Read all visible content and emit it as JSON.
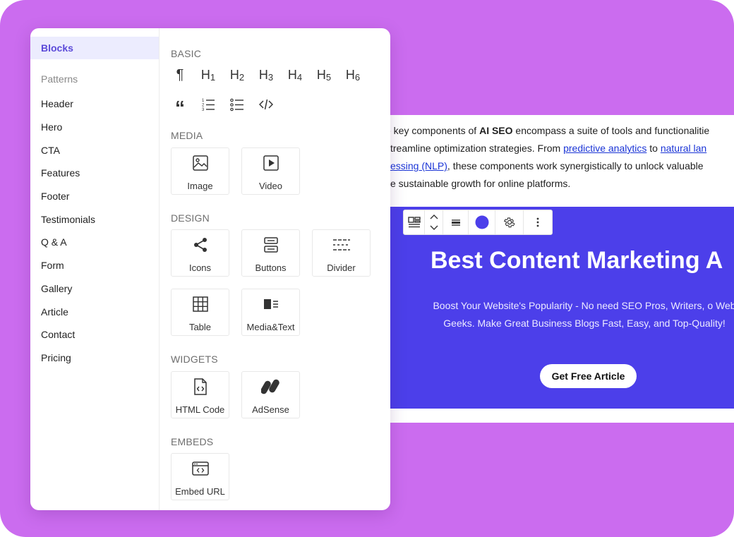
{
  "sidebar": {
    "items": [
      {
        "label": "Blocks"
      },
      {
        "label": "Patterns"
      },
      {
        "label": "Header"
      },
      {
        "label": "Hero"
      },
      {
        "label": "CTA"
      },
      {
        "label": "Features"
      },
      {
        "label": "Footer"
      },
      {
        "label": "Testimonials"
      },
      {
        "label": "Q & A"
      },
      {
        "label": "Form"
      },
      {
        "label": "Gallery"
      },
      {
        "label": "Article"
      },
      {
        "label": "Contact"
      },
      {
        "label": "Pricing"
      }
    ]
  },
  "sections": {
    "basic": {
      "title": "BASIC"
    },
    "media": {
      "title": "MEDIA",
      "blocks": [
        "Image",
        "Video"
      ]
    },
    "design": {
      "title": "DESIGN",
      "blocks": [
        "Icons",
        "Buttons",
        "Divider",
        "Table",
        "Media&Text"
      ]
    },
    "widgets": {
      "title": "WIDGETS",
      "blocks": [
        "HTML Code",
        "AdSense"
      ]
    },
    "embeds": {
      "title": "EMBEDS",
      "blocks": [
        "Embed URL"
      ]
    }
  },
  "basic_glyphs": {
    "paragraph": "¶",
    "h1_letter": "H",
    "h1_num": "1",
    "h2_letter": "H",
    "h2_num": "2",
    "h3_letter": "H",
    "h3_num": "3",
    "h4_letter": "H",
    "h4_num": "4",
    "h5_letter": "H",
    "h5_num": "5",
    "h6_letter": "H",
    "h6_num": "6",
    "quote": "“"
  },
  "content": {
    "line1_pre": "e key components of ",
    "line1_bold": "AI SEO",
    "line1_post": " encompass a suite of tools and functionalitie",
    "line2_pre": "streamline optimization strategies. From ",
    "line2_link1": "predictive analytics",
    "line2_mid": " to ",
    "line2_link2": "natural lan",
    "line3_link": "cessing (NLP)",
    "line3_post": ", these components work synergistically to unlock valuable",
    "line4": "ve sustainable growth for online platforms."
  },
  "hero": {
    "title": "Best Content Marketing A",
    "subtitle": "Boost Your Website's Popularity - No need SEO Pros, Writers, o Web Geeks. Make Great Business Blogs Fast, Easy, and Top-Quality!",
    "cta": "Get Free Article"
  },
  "colors": {
    "background": "#cb6cef",
    "accent": "#5b4ad9",
    "hero_bg": "#4c3fea",
    "toolbar_swatch": "#4c3fea"
  },
  "icons": {
    "toolbar": [
      "layout-icon",
      "move-arrows-icon",
      "align-icon",
      "color-swatch-icon",
      "gear-icon",
      "more-vertical-icon"
    ]
  }
}
